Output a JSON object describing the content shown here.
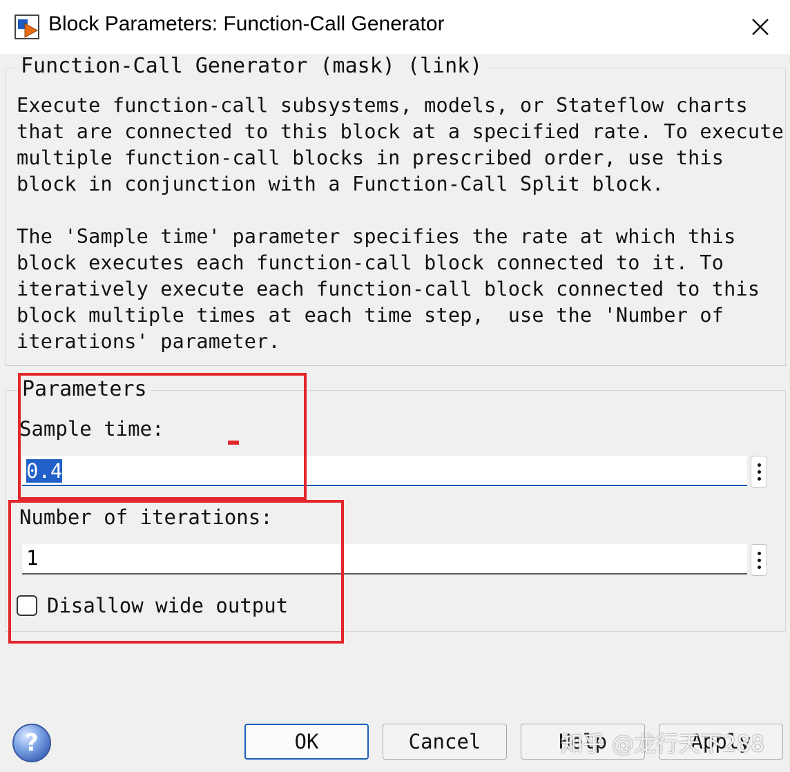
{
  "window": {
    "title": "Block Parameters: Function-Call Generator",
    "close_glyph": "✕",
    "icon": "simulink-block-icon"
  },
  "mask": {
    "legend": "Function-Call Generator (mask) (link)",
    "description_lines": [
      "Execute function-call subsystems, models, or Stateflow charts",
      "that are connected to this block at a specified rate. To execute",
      "multiple function-call blocks in prescribed order, use this",
      "block in conjunction with a Function-Call Split block.",
      "The 'Sample time' parameter specifies the rate at which this",
      "block executes each function-call block connected to it. To",
      "iteratively execute each function-call block connected to this",
      "block multiple times at each time step,  use the 'Number of",
      "iterations' parameter."
    ]
  },
  "parameters": {
    "legend": "Parameters",
    "sample_time": {
      "label": "Sample time:",
      "value": "0.4"
    },
    "iterations": {
      "label": "Number of iterations:",
      "value": "1"
    },
    "disallow_wide": {
      "label": "Disallow wide output",
      "checked": false
    }
  },
  "buttons": {
    "ok": "OK",
    "cancel": "Cancel",
    "help": "Help",
    "apply": "Apply"
  },
  "help_glyph": "?",
  "watermark": "知乎 @龙行天下288",
  "colors": {
    "highlight": "#e3262b",
    "accent": "#1a5fb4",
    "selection": "#2060c8"
  }
}
